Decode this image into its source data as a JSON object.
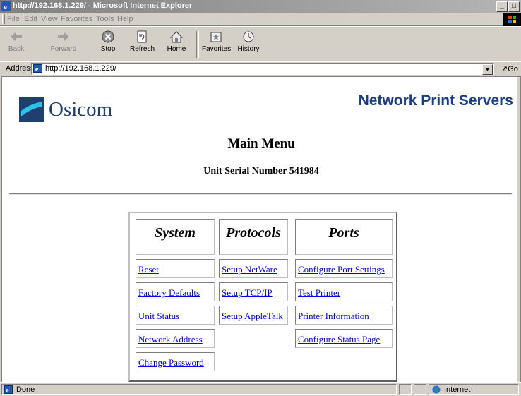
{
  "window": {
    "title": "http://192.168.1.229/ - Microsoft Internet Explorer",
    "controls": [
      "_",
      "□",
      "×"
    ]
  },
  "menubar": {
    "items": [
      "File",
      "Edit",
      "View",
      "Favorites",
      "Tools",
      "Help"
    ]
  },
  "toolbar": {
    "buttons": [
      {
        "label": "Back",
        "icon": "back-arrow-icon",
        "enabled": false
      },
      {
        "label": "Forward",
        "icon": "forward-arrow-icon",
        "enabled": false
      },
      {
        "label": "Stop",
        "icon": "stop-icon",
        "enabled": true
      },
      {
        "label": "Refresh",
        "icon": "refresh-icon",
        "enabled": true
      },
      {
        "label": "Home",
        "icon": "home-icon",
        "enabled": true
      },
      {
        "label": "Favorites",
        "icon": "favorites-icon",
        "enabled": true
      },
      {
        "label": "History",
        "icon": "history-icon",
        "enabled": true
      }
    ]
  },
  "address": {
    "label": "Address",
    "url": "http://192.168.1.229/",
    "go_label": "Go"
  },
  "page": {
    "logo_text": "Osicom",
    "header_title": "Network Print Servers",
    "main_menu": "Main Menu",
    "serial": "Unit Serial Number 541984",
    "columns": [
      {
        "title": "System",
        "links": [
          "Reset",
          "Factory Defaults",
          "Unit Status",
          "Network Address",
          "Change Password"
        ]
      },
      {
        "title": "Protocols",
        "links": [
          "Setup NetWare",
          "Setup TCP/IP",
          "Setup AppleTalk"
        ]
      },
      {
        "title": "Ports",
        "links": [
          "Configure Port Settings",
          "Test Printer",
          "Printer Information",
          "Configure Status Page"
        ]
      }
    ]
  },
  "status": {
    "text": "Done",
    "zone": "Internet"
  },
  "colors": {
    "link": "#0000ee",
    "brand": "#1a3e86",
    "chrome": "#d4d0c8"
  }
}
